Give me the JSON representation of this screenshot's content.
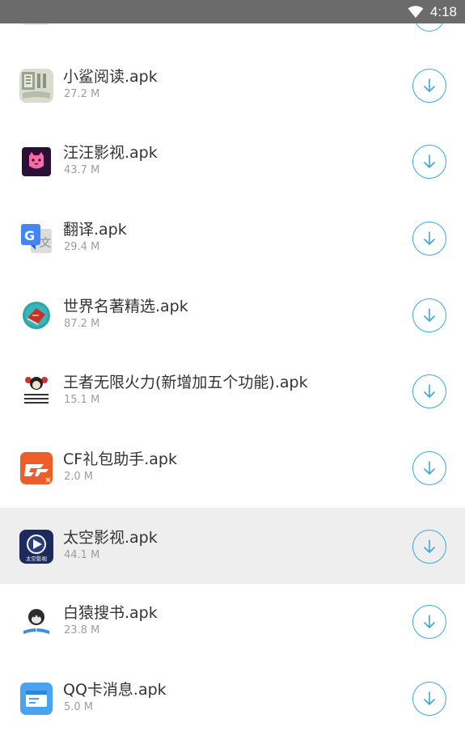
{
  "status_bar": {
    "time": "4:18",
    "wifi_icon": "wifi-icon"
  },
  "accent_color": "#3aa9dd",
  "items": [
    {
      "name": "小鲨阅读.apk",
      "size": "27.2 M",
      "icon": "xiaosha-reader-icon"
    },
    {
      "name": "汪汪影视.apk",
      "size": "43.7 M",
      "icon": "wangwang-video-icon"
    },
    {
      "name": "翻译.apk",
      "size": "29.4 M",
      "icon": "google-translate-icon"
    },
    {
      "name": "世界名著精选.apk",
      "size": "87.2 M",
      "icon": "world-classics-icon"
    },
    {
      "name": "王者无限火力(新增加五个功能).apk",
      "size": "15.1 M",
      "icon": "wangzhe-meme-icon"
    },
    {
      "name": "CF礼包助手.apk",
      "size": "2.0 M",
      "icon": "cf-gift-icon"
    },
    {
      "name": "太空影视.apk",
      "size": "44.1 M",
      "icon": "space-video-icon",
      "icon_label": "太空影视",
      "highlighted": true
    },
    {
      "name": "白猿搜书.apk",
      "size": "23.8 M",
      "icon": "ape-book-search-icon"
    },
    {
      "name": "QQ卡消息.apk",
      "size": "5.0 M",
      "icon": "qq-card-message-icon"
    }
  ]
}
